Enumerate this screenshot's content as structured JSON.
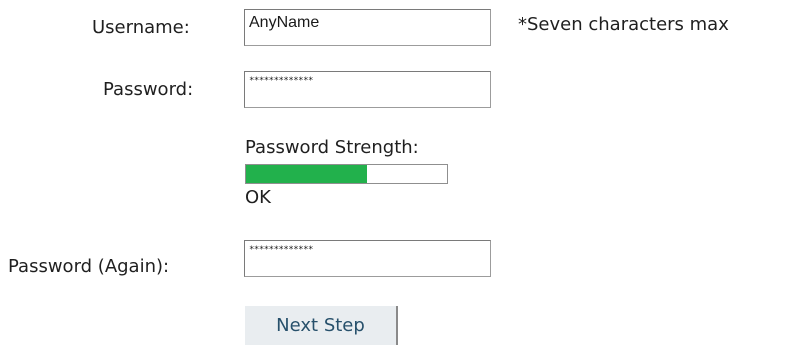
{
  "form": {
    "username": {
      "label": "Username:",
      "value": "AnyName",
      "note": "*Seven characters max"
    },
    "password": {
      "label": "Password:",
      "value": "*************"
    },
    "strength": {
      "title": "Password Strength:",
      "level_fraction": 0.6,
      "status": "OK",
      "fill_color": "#22b14c"
    },
    "password_again": {
      "label": "Password (Again):",
      "value": "*************"
    },
    "next_button": {
      "label": "Next Step"
    }
  }
}
